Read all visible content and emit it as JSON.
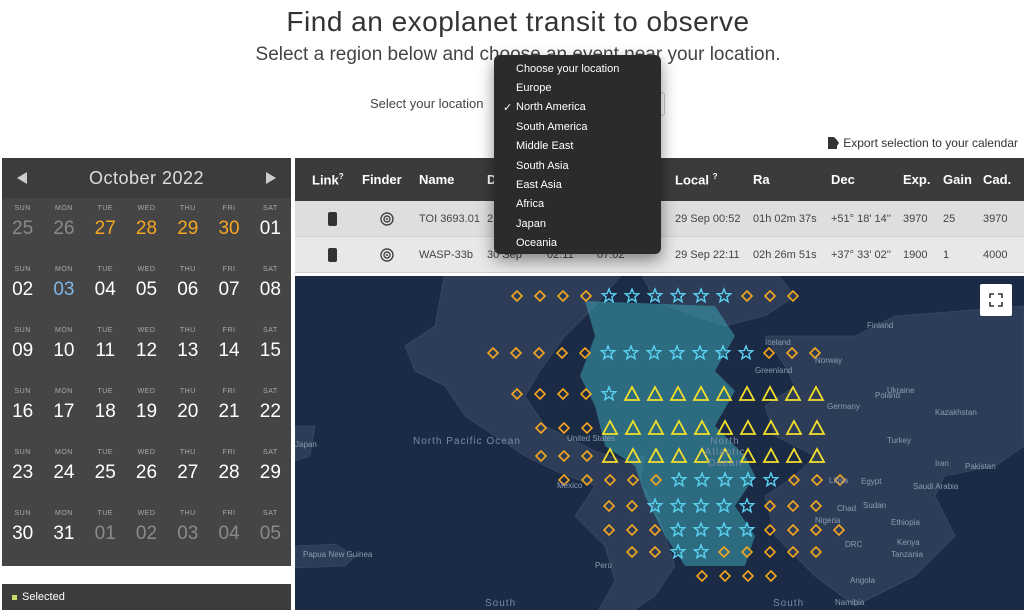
{
  "header": {
    "title": "Find an exoplanet transit to observe",
    "subtitle": "Select a region below and choose an event near your location."
  },
  "location": {
    "label": "Select your location",
    "options": [
      "Choose your location",
      "Europe",
      "North America",
      "South America",
      "Middle East",
      "South Asia",
      "East Asia",
      "Africa",
      "Japan",
      "Oceania"
    ],
    "selected": "North America"
  },
  "export_label": "Export selection to your calendar",
  "calendar": {
    "month": "October 2022",
    "prev_icon": "triangle-left-icon",
    "next_icon": "triangle-right-icon",
    "weeks": [
      [
        {
          "dow": "SUN",
          "d": "25",
          "s": "muted"
        },
        {
          "dow": "MON",
          "d": "26",
          "s": "muted"
        },
        {
          "dow": "TUE",
          "d": "27",
          "s": "orange"
        },
        {
          "dow": "WED",
          "d": "28",
          "s": "orange"
        },
        {
          "dow": "THU",
          "d": "29",
          "s": "orange"
        },
        {
          "dow": "FRI",
          "d": "30",
          "s": "orange"
        },
        {
          "dow": "SAT",
          "d": "01",
          "s": ""
        }
      ],
      [
        {
          "dow": "SUN",
          "d": "02",
          "s": ""
        },
        {
          "dow": "MON",
          "d": "03",
          "s": "today"
        },
        {
          "dow": "TUE",
          "d": "04",
          "s": ""
        },
        {
          "dow": "WED",
          "d": "05",
          "s": ""
        },
        {
          "dow": "THU",
          "d": "06",
          "s": ""
        },
        {
          "dow": "FRI",
          "d": "07",
          "s": ""
        },
        {
          "dow": "SAT",
          "d": "08",
          "s": ""
        }
      ],
      [
        {
          "dow": "SUN",
          "d": "09",
          "s": ""
        },
        {
          "dow": "MON",
          "d": "10",
          "s": ""
        },
        {
          "dow": "TUE",
          "d": "11",
          "s": ""
        },
        {
          "dow": "WED",
          "d": "12",
          "s": ""
        },
        {
          "dow": "THU",
          "d": "13",
          "s": ""
        },
        {
          "dow": "FRI",
          "d": "14",
          "s": ""
        },
        {
          "dow": "SAT",
          "d": "15",
          "s": ""
        }
      ],
      [
        {
          "dow": "SUN",
          "d": "16",
          "s": ""
        },
        {
          "dow": "MON",
          "d": "17",
          "s": ""
        },
        {
          "dow": "TUE",
          "d": "18",
          "s": ""
        },
        {
          "dow": "WED",
          "d": "19",
          "s": ""
        },
        {
          "dow": "THU",
          "d": "20",
          "s": ""
        },
        {
          "dow": "FRI",
          "d": "21",
          "s": ""
        },
        {
          "dow": "SAT",
          "d": "22",
          "s": ""
        }
      ],
      [
        {
          "dow": "SUN",
          "d": "23",
          "s": ""
        },
        {
          "dow": "MON",
          "d": "24",
          "s": ""
        },
        {
          "dow": "TUE",
          "d": "25",
          "s": ""
        },
        {
          "dow": "WED",
          "d": "26",
          "s": ""
        },
        {
          "dow": "THU",
          "d": "27",
          "s": ""
        },
        {
          "dow": "FRI",
          "d": "28",
          "s": ""
        },
        {
          "dow": "SAT",
          "d": "29",
          "s": ""
        }
      ],
      [
        {
          "dow": "SUN",
          "d": "30",
          "s": ""
        },
        {
          "dow": "MON",
          "d": "31",
          "s": ""
        },
        {
          "dow": "TUE",
          "d": "01",
          "s": "muted"
        },
        {
          "dow": "WED",
          "d": "02",
          "s": "muted"
        },
        {
          "dow": "THU",
          "d": "03",
          "s": "muted"
        },
        {
          "dow": "FRI",
          "d": "04",
          "s": "muted"
        },
        {
          "dow": "SAT",
          "d": "05",
          "s": "muted"
        }
      ]
    ]
  },
  "legend": {
    "selected_label": "Selected"
  },
  "table": {
    "headers": {
      "link": "Link",
      "finder": "Finder",
      "name": "Name",
      "date": "D",
      "local": "Local",
      "ra": "Ra",
      "dec": "Dec",
      "exp": "Exp.",
      "gain": "Gain",
      "cad": "Cad."
    },
    "help_mark": "?",
    "rows": [
      {
        "name": "TOI 3693.01",
        "date": "2",
        "start": "",
        "end": "",
        "local": "29 Sep 00:52",
        "ra": "01h 02m 37s",
        "dec": "+51° 18' 14''",
        "exp": "3970",
        "gain": "25",
        "cad": "3970"
      },
      {
        "name": "WASP-33b",
        "date": "30 Sep",
        "start": "02:11",
        "end": "07:02",
        "local": "29 Sep 22:11",
        "ra": "02h 26m 51s",
        "dec": "+37° 33' 02''",
        "exp": "1900",
        "gain": "1",
        "cad": "4000"
      }
    ]
  },
  "map": {
    "labels": [
      {
        "t": "Japan"
      },
      {
        "t": "Papua New Guinea"
      },
      {
        "t": "Iceland"
      },
      {
        "t": "Finland"
      },
      {
        "t": "Norway"
      },
      {
        "t": "Poland"
      },
      {
        "t": "Germany"
      },
      {
        "t": "Ukraine"
      },
      {
        "t": "Kazakhstan"
      },
      {
        "t": "Turkey"
      },
      {
        "t": "Iran"
      },
      {
        "t": "Pakistan"
      },
      {
        "t": "Saudi Arabia"
      },
      {
        "t": "Libya"
      },
      {
        "t": "Egypt"
      },
      {
        "t": "Sudan"
      },
      {
        "t": "Chad"
      },
      {
        "t": "Nigeria"
      },
      {
        "t": "Ethiopia"
      },
      {
        "t": "Kenya"
      },
      {
        "t": "DRC"
      },
      {
        "t": "Tanzania"
      },
      {
        "t": "Angola"
      },
      {
        "t": "Namibia"
      },
      {
        "t": "Greenland"
      },
      {
        "t": "United States"
      },
      {
        "t": "Mexico"
      },
      {
        "t": "Peru"
      }
    ],
    "oceans": [
      "North Pacific Ocean",
      "North Atlantic Ocean",
      "South",
      "South"
    ],
    "colors": {
      "diamond": "#f5a623",
      "star": "#5ad1f0",
      "triangle": "#f2e02c",
      "highlight": "#3aa0b0"
    }
  }
}
